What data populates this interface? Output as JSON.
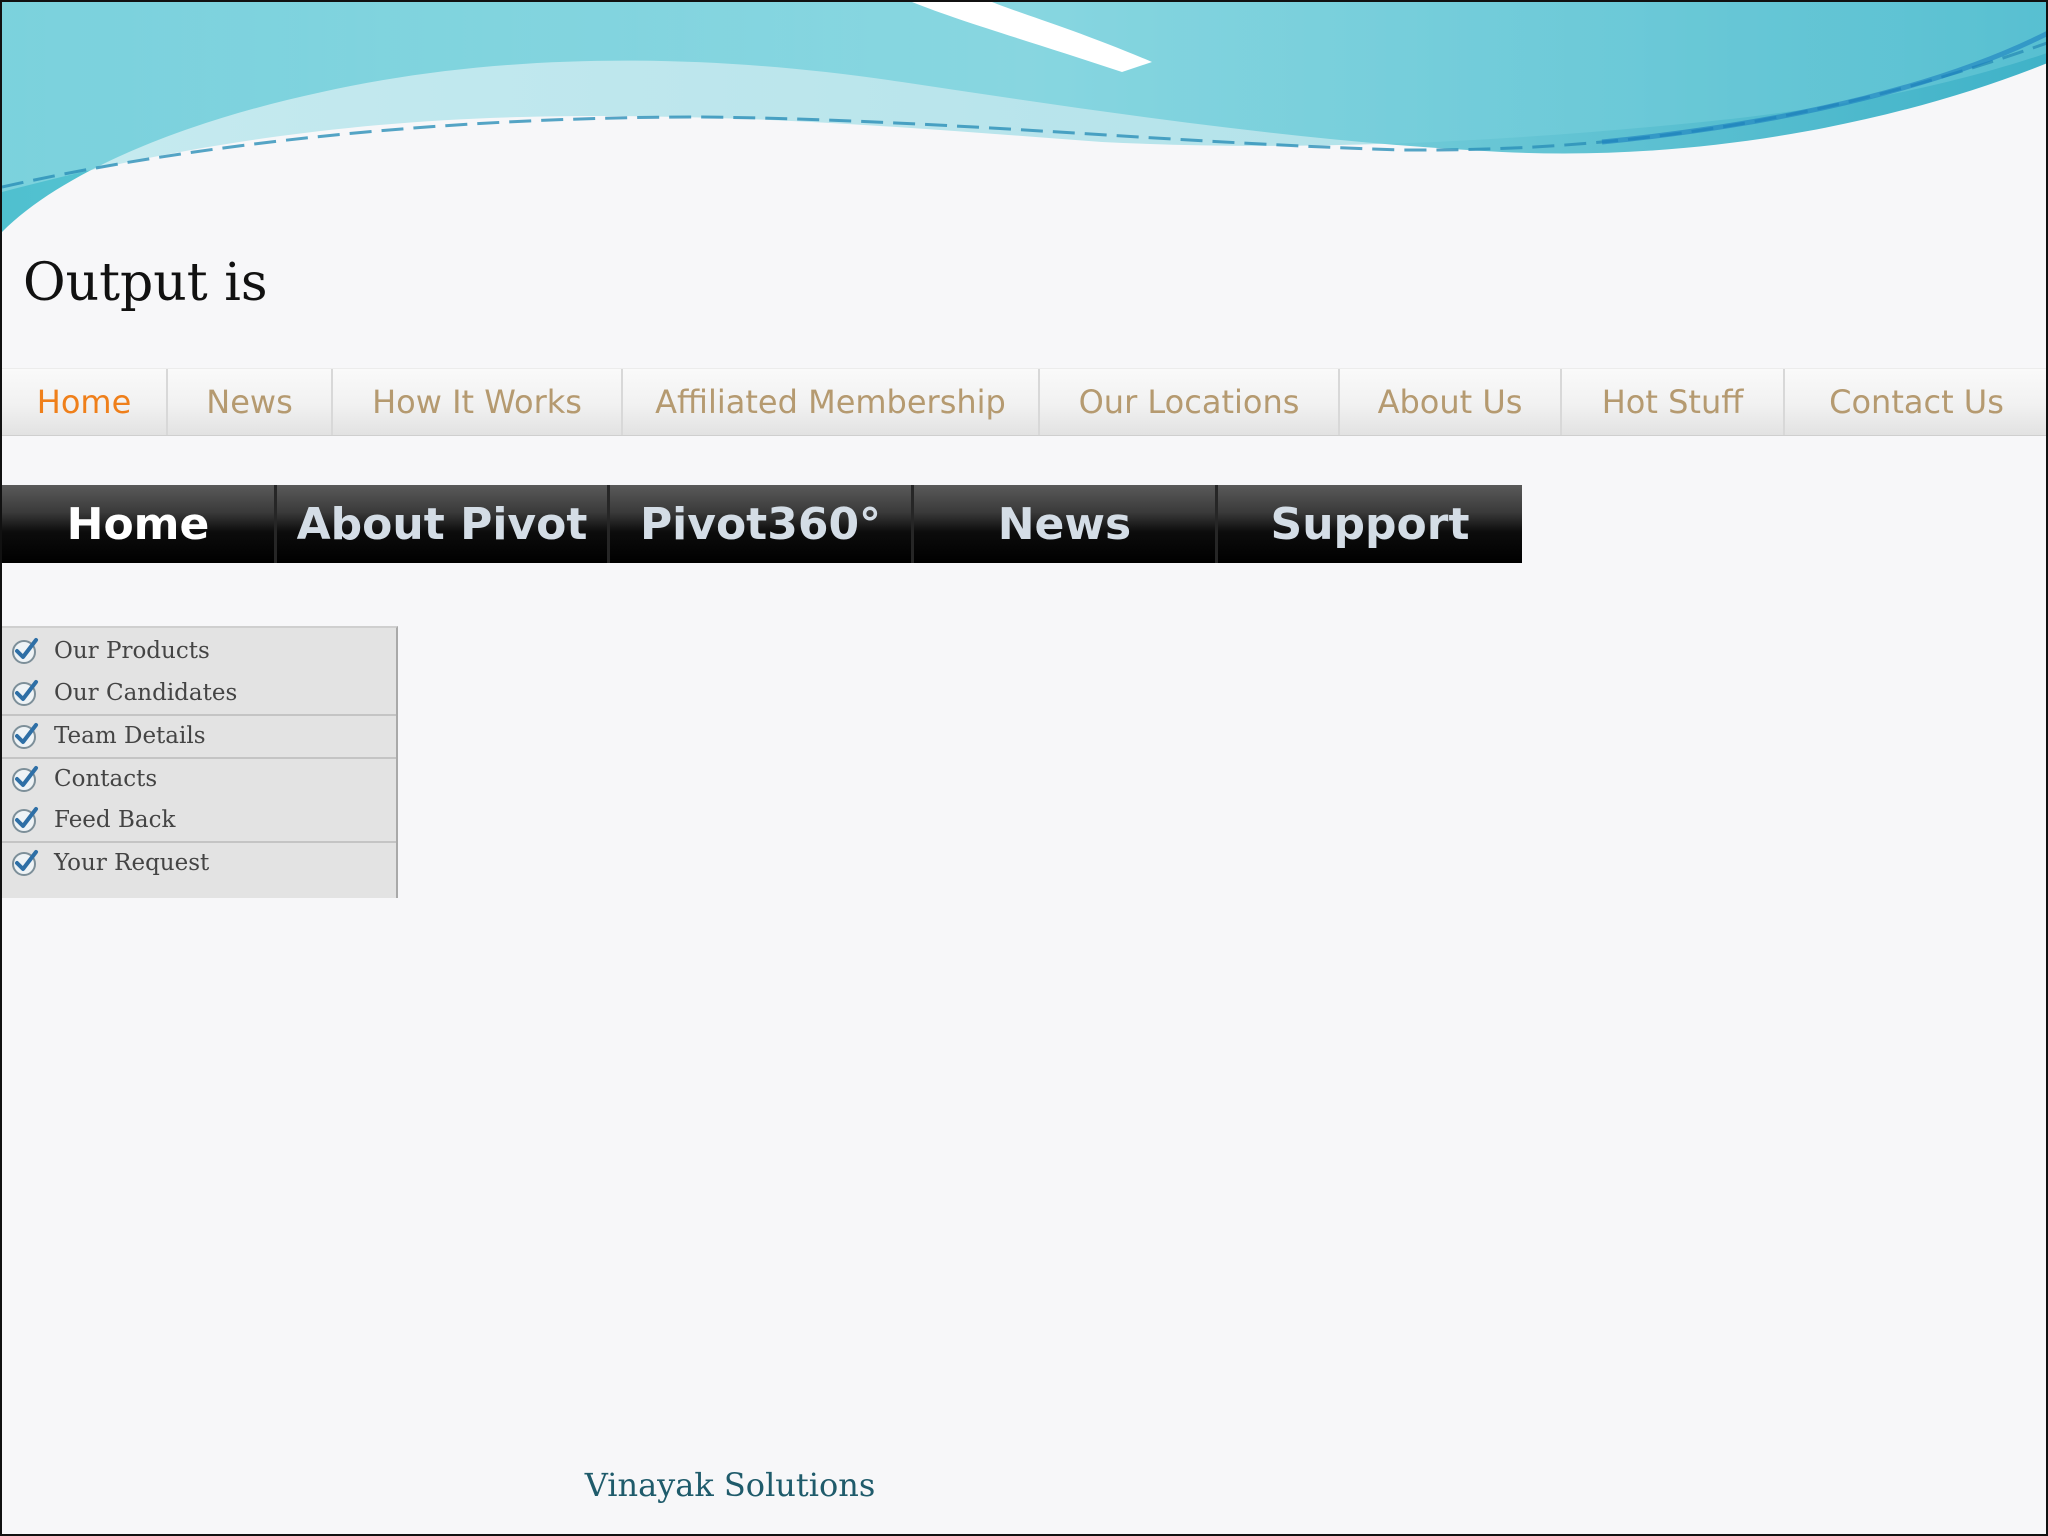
{
  "slide": {
    "title": "Output is",
    "footer": "Vinayak Solutions"
  },
  "nav_light": {
    "items": [
      {
        "label": "Home",
        "active": true
      },
      {
        "label": "News"
      },
      {
        "label": "How It Works"
      },
      {
        "label": "Affiliated Membership"
      },
      {
        "label": "Our Locations"
      },
      {
        "label": "About Us"
      },
      {
        "label": "Hot Stuff"
      },
      {
        "label": "Contact Us"
      }
    ]
  },
  "nav_dark": {
    "items": [
      {
        "label": "Home",
        "active": true
      },
      {
        "label": "About Pivot"
      },
      {
        "label": "Pivot360°"
      },
      {
        "label": "News"
      },
      {
        "label": "Support"
      }
    ]
  },
  "side_menu": {
    "items": [
      {
        "label": "Our Products"
      },
      {
        "label": "Our Candidates"
      },
      {
        "label": "Team Details"
      },
      {
        "label": "Contacts"
      },
      {
        "label": "Feed Back"
      },
      {
        "label": "Your Request"
      }
    ]
  },
  "colors": {
    "wave": "#5cc6d6",
    "nav_light_text": "#b59a70",
    "nav_light_active": "#ef7f1a",
    "nav_dark_text": "#d4dde6",
    "footer_text": "#1f5b6b"
  },
  "icons": {
    "menu_item": "check-circle-icon"
  }
}
